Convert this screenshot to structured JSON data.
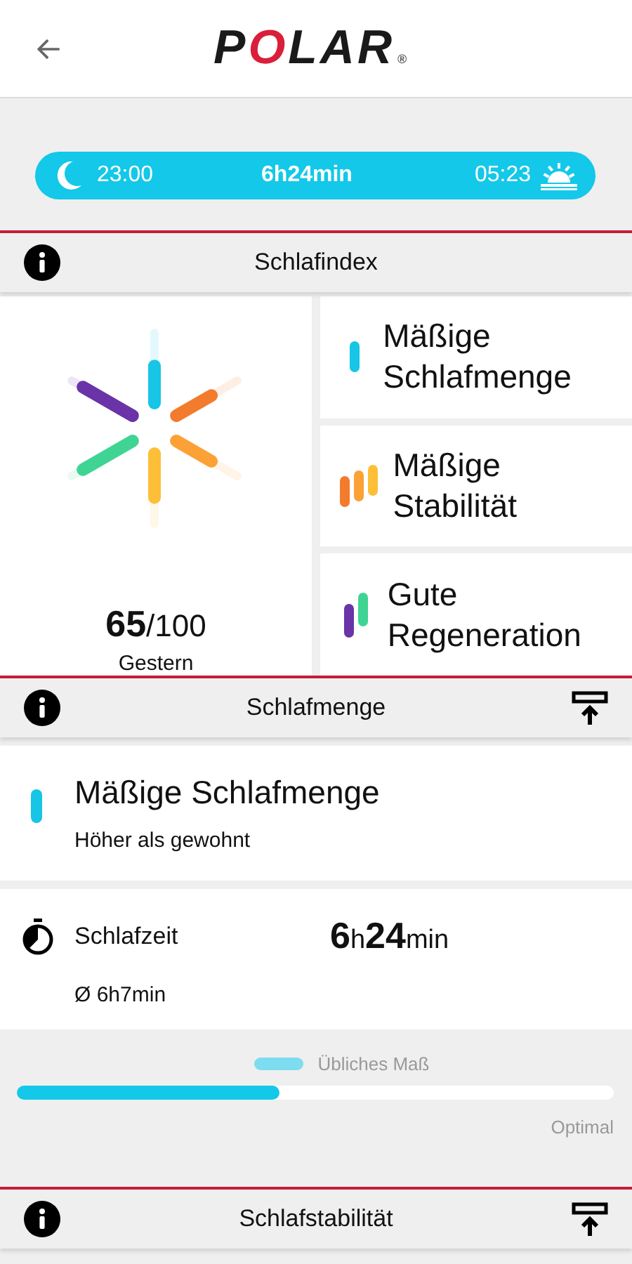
{
  "header": {
    "logo": "POLAR",
    "logo_mark": "®"
  },
  "sleep_bar": {
    "start": "23:00",
    "duration": "6h24min",
    "end": "05:23"
  },
  "sections": [
    {
      "title": "Schlafindex",
      "pin": false
    },
    {
      "title": "Schlafmenge",
      "pin": true
    },
    {
      "title": "Schlafstabilität",
      "pin": true
    }
  ],
  "sleep_index": {
    "score": "65",
    "max": "/100",
    "day": "Gestern",
    "cards": [
      {
        "kind": "amount",
        "label": "Mäßige Schlafmenge"
      },
      {
        "kind": "stability",
        "label": "Mäßige Stabilität"
      },
      {
        "kind": "regeneration",
        "label": "Gute Regeneration"
      }
    ]
  },
  "amount": {
    "title": "Mäßige Schlafmenge",
    "subtitle": "Höher als gewohnt",
    "time_label": "Schlafzeit",
    "time_value": "**6**h**24**min",
    "average": "Ø 6h7min",
    "legend": "Übliches Maß",
    "level": 0.44,
    "scale_label": "Optimal"
  }
}
